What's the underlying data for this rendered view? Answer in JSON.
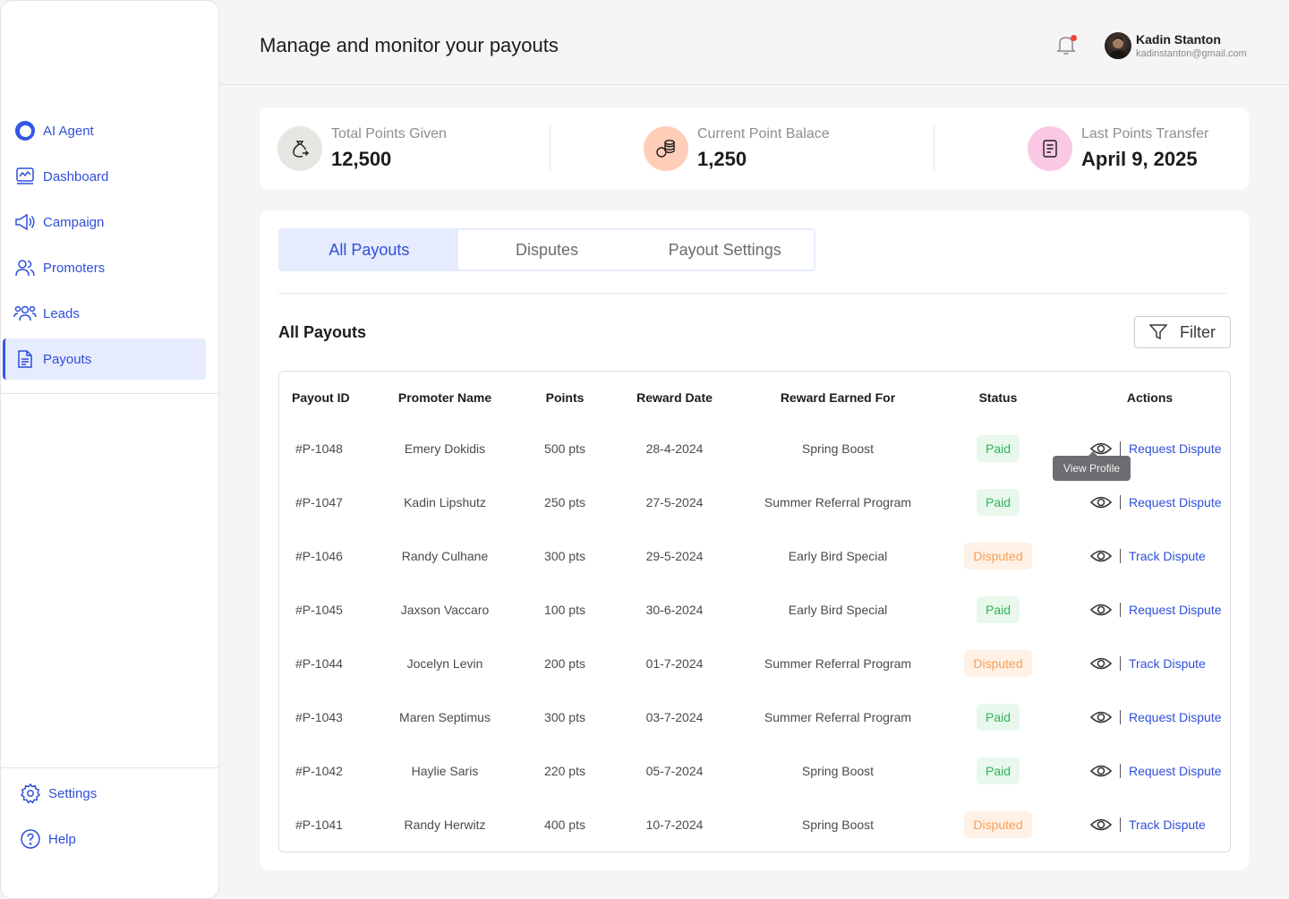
{
  "sidebar": {
    "items": [
      {
        "label": "AI Agent",
        "icon": "ai-agent-icon"
      },
      {
        "label": "Dashboard",
        "icon": "dashboard-icon"
      },
      {
        "label": "Campaign",
        "icon": "megaphone-icon"
      },
      {
        "label": "Promoters",
        "icon": "users-icon"
      },
      {
        "label": "Leads",
        "icon": "leads-icon"
      },
      {
        "label": "Payouts",
        "icon": "document-icon",
        "active": true
      }
    ],
    "bottom": [
      {
        "label": "Settings",
        "icon": "gear-icon"
      },
      {
        "label": "Help",
        "icon": "help-icon"
      }
    ]
  },
  "header": {
    "title": "Manage and monitor your payouts",
    "user_name": "Kadin Stanton",
    "user_email": "kadinstanton@gmail.com"
  },
  "stats": [
    {
      "label": "Total Points Given",
      "value": "12,500",
      "icon": "money-bag-icon"
    },
    {
      "label": "Current Point Balace",
      "value": "1,250",
      "icon": "coins-icon"
    },
    {
      "label": "Last Points Transfer",
      "value": "April 9, 2025",
      "icon": "receipt-icon"
    }
  ],
  "tabs": [
    {
      "label": "All Payouts",
      "active": true
    },
    {
      "label": "Disputes"
    },
    {
      "label": "Payout Settings"
    }
  ],
  "section": {
    "title": "All Payouts",
    "filter_label": "Filter"
  },
  "table": {
    "headers": [
      "Payout ID",
      "Promoter Name",
      "Points",
      "Reward Date",
      "Reward Earned For",
      "Status",
      "Actions"
    ],
    "rows": [
      {
        "id": "#P-1048",
        "name": "Emery Dokidis",
        "points": "500 pts",
        "date": "28-4-2024",
        "reason": "Spring Boost",
        "status": "Paid",
        "action": "Request Dispute"
      },
      {
        "id": "#P-1047",
        "name": "Kadin Lipshutz",
        "points": "250 pts",
        "date": "27-5-2024",
        "reason": "Summer Referral Program",
        "status": "Paid",
        "action": "Request Dispute"
      },
      {
        "id": "#P-1046",
        "name": "Randy Culhane",
        "points": "300 pts",
        "date": "29-5-2024",
        "reason": "Early Bird Special",
        "status": "Disputed",
        "action": "Track Dispute"
      },
      {
        "id": "#P-1045",
        "name": "Jaxson Vaccaro",
        "points": "100 pts",
        "date": "30-6-2024",
        "reason": "Early Bird Special",
        "status": "Paid",
        "action": "Request Dispute"
      },
      {
        "id": "#P-1044",
        "name": "Jocelyn Levin",
        "points": "200 pts",
        "date": "01-7-2024",
        "reason": "Summer Referral Program",
        "status": "Disputed",
        "action": "Track Dispute"
      },
      {
        "id": "#P-1043",
        "name": "Maren Septimus",
        "points": "300 pts",
        "date": "03-7-2024",
        "reason": "Summer Referral Program",
        "status": "Paid",
        "action": "Request Dispute"
      },
      {
        "id": "#P-1042",
        "name": "Haylie Saris",
        "points": "220 pts",
        "date": "05-7-2024",
        "reason": "Spring Boost",
        "status": "Paid",
        "action": "Request Dispute"
      },
      {
        "id": "#P-1041",
        "name": "Randy Herwitz",
        "points": "400 pts",
        "date": "10-7-2024",
        "reason": "Spring Boost",
        "status": "Disputed",
        "action": "Track Dispute"
      }
    ],
    "tooltip": "View Profile"
  },
  "colors": {
    "accent": "#2f4fd9",
    "active_bg": "#e6ecfd",
    "paid": "#2fb457",
    "disputed": "#f5a15a"
  }
}
